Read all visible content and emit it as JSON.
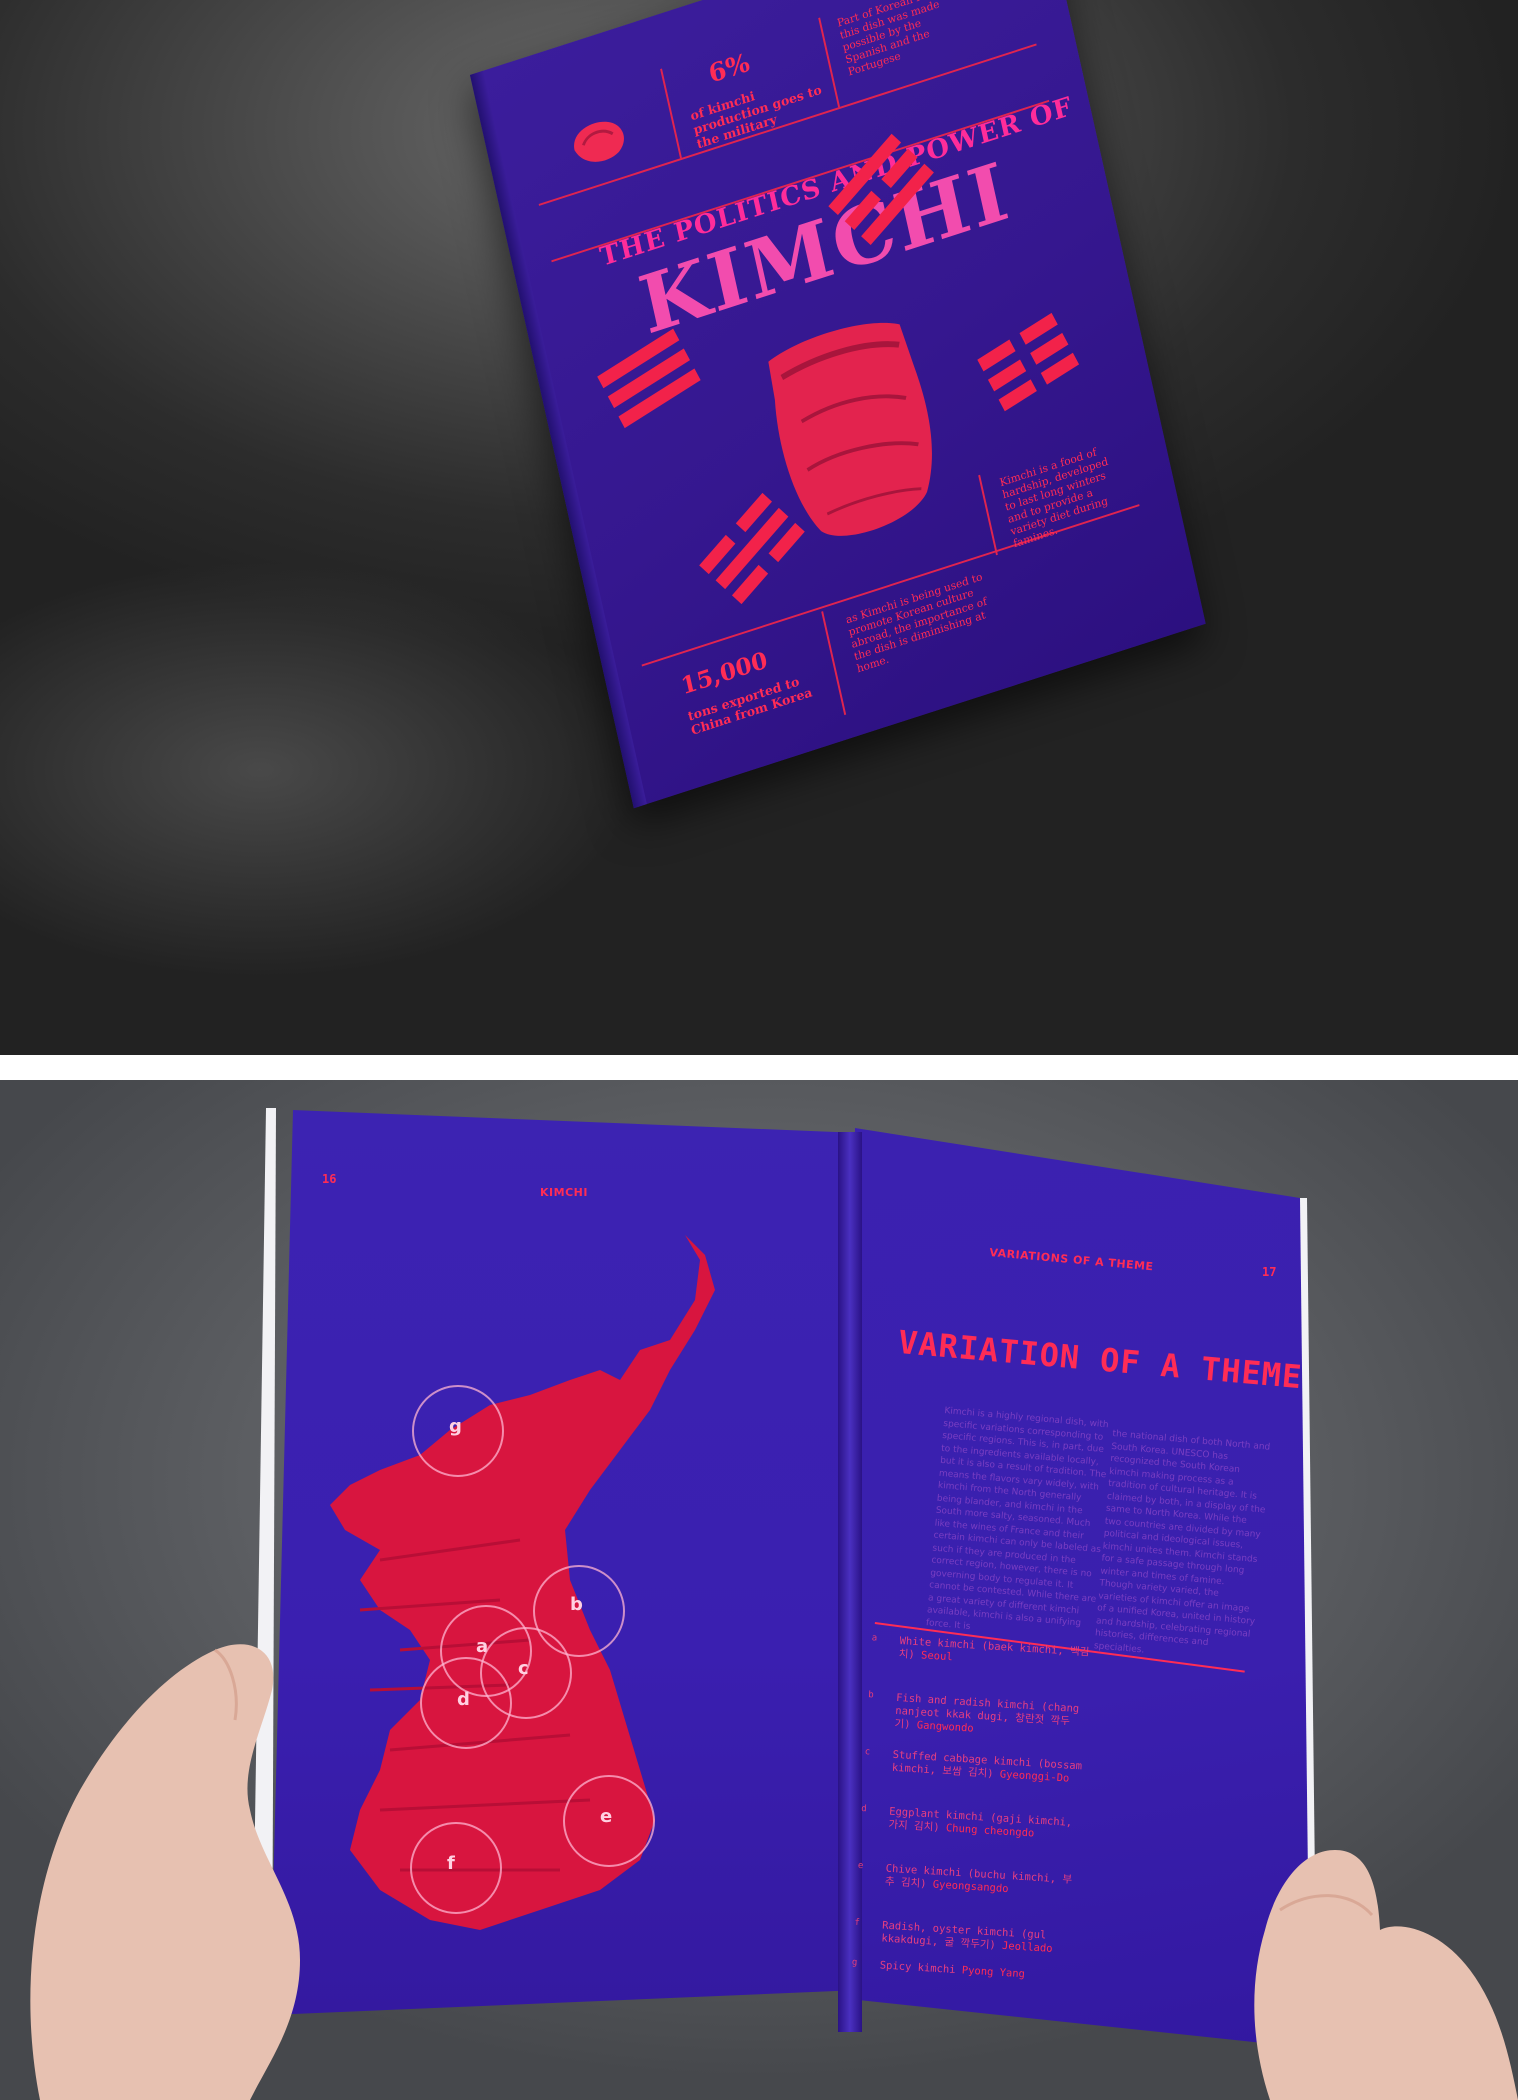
{
  "cover": {
    "stat_top_value": "6%",
    "stat_top_caption": "of kimchi production goes to the military",
    "side_text_top": "Part of Korean identity, this dish was made possible by the Spanish and the Portugese",
    "supertitle": "THE POLITICS AND POWER OF",
    "title": "KIMCHI",
    "side_text_right": "Kimchi is a food of hardship, developed to last long winters and to provide a variety diet during famines.",
    "mid_text": "as Kimchi is being used to promote Korean culture abroad, the importance of the dish is diminishing at home.",
    "stat_bottom_value": "15,000",
    "stat_bottom_caption": "tons exported to China from Korea"
  },
  "spread": {
    "left_page_number": "16",
    "left_running_head": "KIMCHI",
    "right_running_head": "VARIATIONS OF A THEME",
    "right_page_number": "17",
    "title": "VARIATION OF A THEME",
    "map_labels": [
      "g",
      "b",
      "a",
      "c",
      "d",
      "e",
      "f"
    ],
    "body_left": "Kimchi is a highly regional dish, with specific variations corresponding to specific regions. This is, in part, due to the ingredients available locally, but it is also a result of tradition. The means the flavors vary widely, with kimchi from the North generally being blander, and kimchi in the South more salty, seasoned. Much like the wines of France and their certain kimchi can only be labeled as such if they are produced in the correct region, however, there is no governing body to regulate it. It cannot be contested. While there are a great variety of different kimchi available, kimchi is also a unifying force. It is",
    "body_right": "the national dish of both North and South Korea. UNESCO has recognized the South Korean kimchi making process as a tradition of cultural heritage. It is claimed by both, in a display of the same to North Korea. While the two countries are divided by many political and ideological issues, kimchi unites them. Kimchi stands for a safe passage through long winter and times of famine. Though variety varied, the varieties of kimchi offer an image of a unified Korea, united in history and hardship, celebrating regional histories, differences and specialties.",
    "list": [
      {
        "letter": "a",
        "name": "White kimchi (baek kimchi, 백김치)",
        "region": "Seoul"
      },
      {
        "letter": "b",
        "name": "Fish and radish kimchi (chang nanjeot kkak dugi, 창란젓 깍두기)",
        "region": "Gangwondo"
      },
      {
        "letter": "c",
        "name": "Stuffed cabbage kimchi (bossam kimchi, 보쌈 김치)",
        "region": "Gyeonggi-Do"
      },
      {
        "letter": "d",
        "name": "Eggplant kimchi (gaji kimchi, 가지 김치)",
        "region": "Chung cheongdo"
      },
      {
        "letter": "e",
        "name": "Chive kimchi (buchu kimchi, 부추 김치)",
        "region": "Gyeongsangdo"
      },
      {
        "letter": "f",
        "name": "Radish, oyster kimchi (gul kkakdugi, 굴 깍두기)",
        "region": "Jeollado"
      },
      {
        "letter": "g",
        "name": "Spicy kimchi",
        "region": "Pyong Yang"
      }
    ]
  },
  "colors": {
    "cover_blue": "#3a1d9a",
    "spread_blue": "#3a1fb0",
    "accent_red": "#ff2c55",
    "title_pink": "#f24cae"
  }
}
